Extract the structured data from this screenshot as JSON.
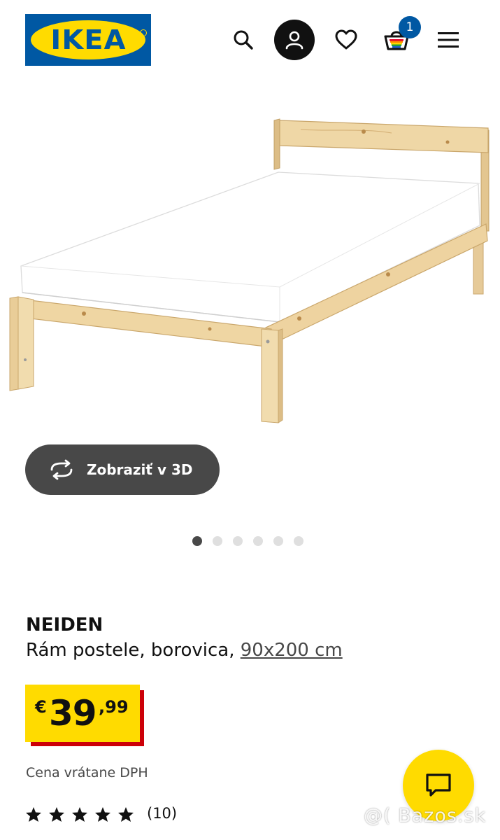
{
  "header": {
    "logo_text": "IKEA",
    "cart_count": "1",
    "icons": [
      "search-icon",
      "profile-icon",
      "heart-icon",
      "basket-icon",
      "menu-icon"
    ]
  },
  "gallery": {
    "view3d_label": "Zobraziť v 3D",
    "slide_count": 6,
    "active_slide": 1
  },
  "product": {
    "name": "NEIDEN",
    "description": "Rám postele, borovica,",
    "size": "90x200 cm",
    "price": {
      "currency": "€",
      "integer": "39",
      "decimal": ",99"
    },
    "vat_note": "Cena vrátane DPH",
    "rating": {
      "stars": 5,
      "max": 5,
      "count": "(10)"
    }
  },
  "watermark": "@( Bazos.sk",
  "colors": {
    "ikea_blue": "#0058a3",
    "ikea_yellow": "#ffdb00",
    "price_shadow": "#cc0008",
    "button_gray": "#484848"
  }
}
